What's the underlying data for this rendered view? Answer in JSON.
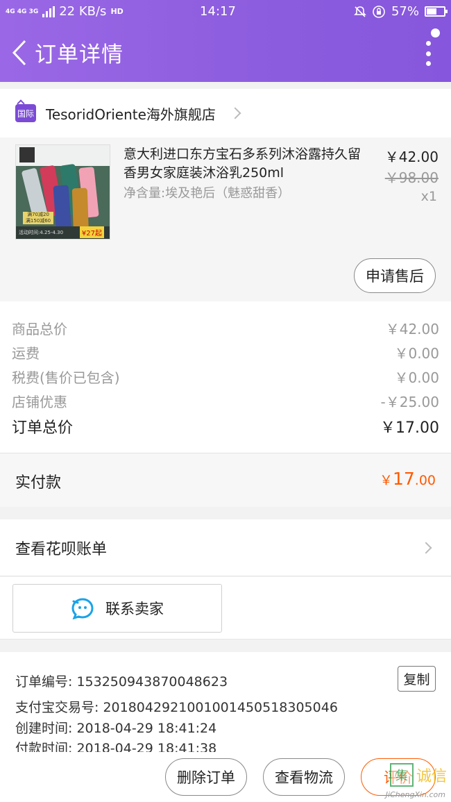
{
  "status_bar": {
    "network_types": "4G 4G 3G",
    "speed": "22 KB/s",
    "time": "14:17",
    "battery": "57%"
  },
  "nav": {
    "title": "订单详情"
  },
  "shop": {
    "badge": "国际",
    "name": "TesoridOriente海外旗舰店"
  },
  "product": {
    "title": "意大利进口东方宝石多系列沐浴露持久留香男女家庭装沐浴乳250ml",
    "spec": "净含量:埃及艳后（魅惑甜香）",
    "price": "￥42.00",
    "original_price": "￥98.00",
    "quantity": "x1",
    "image": {
      "promo_line1": "满70减20",
      "promo_line2": "满150减60",
      "promo_time": "活动时间:4.25-4.30",
      "promo_price": "¥27起"
    },
    "aftersale_label": "申请售后"
  },
  "price_summary": {
    "rows": [
      {
        "label": "商品总价",
        "value": "￥42.00"
      },
      {
        "label": "运费",
        "value": "￥0.00"
      },
      {
        "label": "税费(售价已包含)",
        "value": "￥0.00"
      },
      {
        "label": "店铺优惠",
        "value": "-￥25.00"
      }
    ],
    "total_label": "订单总价",
    "total_value": "￥17.00"
  },
  "payment": {
    "label": "实付款",
    "currency": "￥",
    "integer": "17",
    "decimal": ".00"
  },
  "huabei": {
    "label": "查看花呗账单"
  },
  "contact": {
    "label": "联系卖家"
  },
  "order_info": {
    "order_no": "订单编号: 153250943870048623",
    "alipay_no": "支付宝交易号: 2018042921001001450518305046",
    "created": "创建时间: 2018-04-29 18:41:24",
    "paid": "付款时间: 2018-04-29 18:41:38",
    "copy_label": "复制"
  },
  "bottom_actions": {
    "delete": "删除订单",
    "logistics": "查看物流",
    "review": "评价"
  },
  "watermark": {
    "box": "集",
    "text": "诚信",
    "url": "JiChengXin.com"
  },
  "colors": {
    "header": "#8f5fe0",
    "accent": "#ff5a00"
  }
}
